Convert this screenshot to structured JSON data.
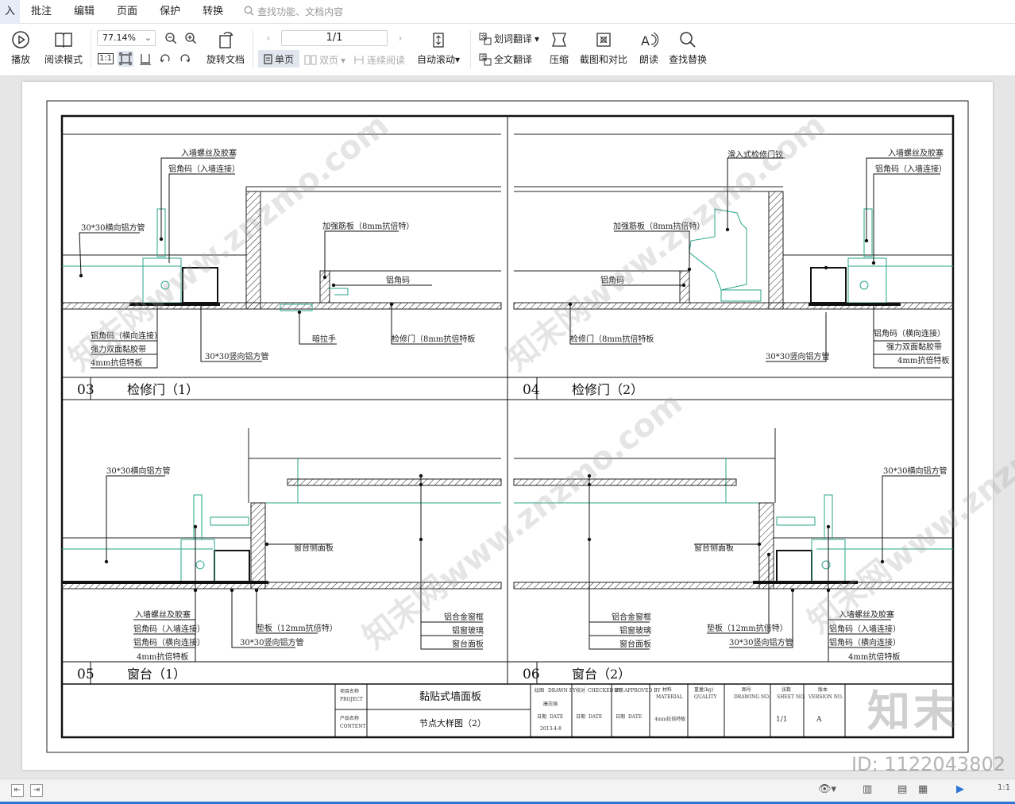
{
  "menu": {
    "items": [
      "入",
      "批注",
      "编辑",
      "页面",
      "保护",
      "转换"
    ],
    "search_placeholder": "查找功能、文档内容"
  },
  "toolbar": {
    "play": "播放",
    "read_mode": "阅读模式",
    "zoom": "77.14%",
    "rotate": "旋转文档",
    "page": "1/1",
    "single": "单页",
    "double": "双页",
    "continuous": "连续阅读",
    "auto_scroll": "自动滚动",
    "word_translate": "划词翻译",
    "full_translate": "全文翻译",
    "compress": "压缩",
    "screenshot_compare": "截图和对比",
    "read_aloud": "朗读",
    "find_replace": "查找替换",
    "fit_actual": "1:1"
  },
  "drawing": {
    "d03": {
      "num": "03",
      "title": "检修门（1）",
      "labels": [
        "入墙螺丝及胶塞",
        "铝角码（入墙连接）",
        "30*30横向铝方管",
        "加强筋板（8mm抗倍特）",
        "铝角码",
        "铝角码（横向连接）",
        "强力双面黏胶带",
        "4mm抗倍特板",
        "30*30竖向铝方管",
        "暗拉手",
        "检修门（8mm抗倍特板"
      ]
    },
    "d04": {
      "num": "04",
      "title": "检修门（2）",
      "labels": [
        "滑入式检修门铰",
        "入墙螺丝及胶塞",
        "铝角码（入墙连接）",
        "加强筋板（8mm抗倍特）",
        "铝角码",
        "检修门（8mm抗倍特板",
        "30*30竖向铝方管",
        "铝角码（横向连接）",
        "强力双面黏胶带",
        "4mm抗倍特板"
      ]
    },
    "d05": {
      "num": "05",
      "title": "窗台（1）",
      "labels": [
        "30*30横向铝方管",
        "窗台侧面板",
        "入墙螺丝及胶塞",
        "铝角码（入墙连接）",
        "铝角码（横向连接）",
        "4mm抗倍特板",
        "垫板（12mm抗倍特）",
        "30*30竖向铝方管",
        "铝合金窗框",
        "铝窗玻璃",
        "窗台面板"
      ]
    },
    "d06": {
      "num": "06",
      "title": "窗台（2）",
      "labels": [
        "30*30横向铝方管",
        "窗台侧面板",
        "铝合金窗框",
        "铝窗玻璃",
        "窗台面板",
        "垫板（12mm抗倍特）",
        "30*30竖向铝方管",
        "入墙螺丝及胶塞",
        "铝角码（入墙连接）",
        "铝角码（横向连接）",
        "4mm抗倍特板"
      ]
    },
    "titleblock": {
      "project_label": "项目名称",
      "project_label_en": "PROJECT",
      "project": "黏贴式墙面板",
      "content_label": "产品名称",
      "content_label_en": "CONTENT",
      "content": "节点大样图（2）",
      "drawn_label": "绘图",
      "drawn_en": "DRAWN BY",
      "drawer": "康志强",
      "date_label": "日期",
      "date_en": "DATE",
      "date": "2013-4-8",
      "checked_label": "校对",
      "checked_en": "CHECKED BY",
      "approved_label": "审核",
      "approved_en": "APPROVED BY",
      "material_label": "材料",
      "material_en": "MATERIAL",
      "material": "4mm抗倍特板",
      "weight_label": "重量(kg)",
      "weight_en": "QUALITY",
      "drawing_no_label": "图号",
      "drawing_no_en": "DRAWING NO.",
      "sheet_label": "张数",
      "sheet_en": "SHEET NO.",
      "sheet": "1/1",
      "version_label": "版本",
      "version_en": "VERSION NO.",
      "version": "A"
    },
    "watermark": "知末网www.znzmo.com",
    "brand": "知末",
    "image_id": "ID: 1122043802"
  },
  "colors": {
    "accent_blue": "#2e75d6",
    "cad_teal": "#2aa58a",
    "ribbon_bg": "#ffffff",
    "doc_bg": "#e6e6e6"
  }
}
